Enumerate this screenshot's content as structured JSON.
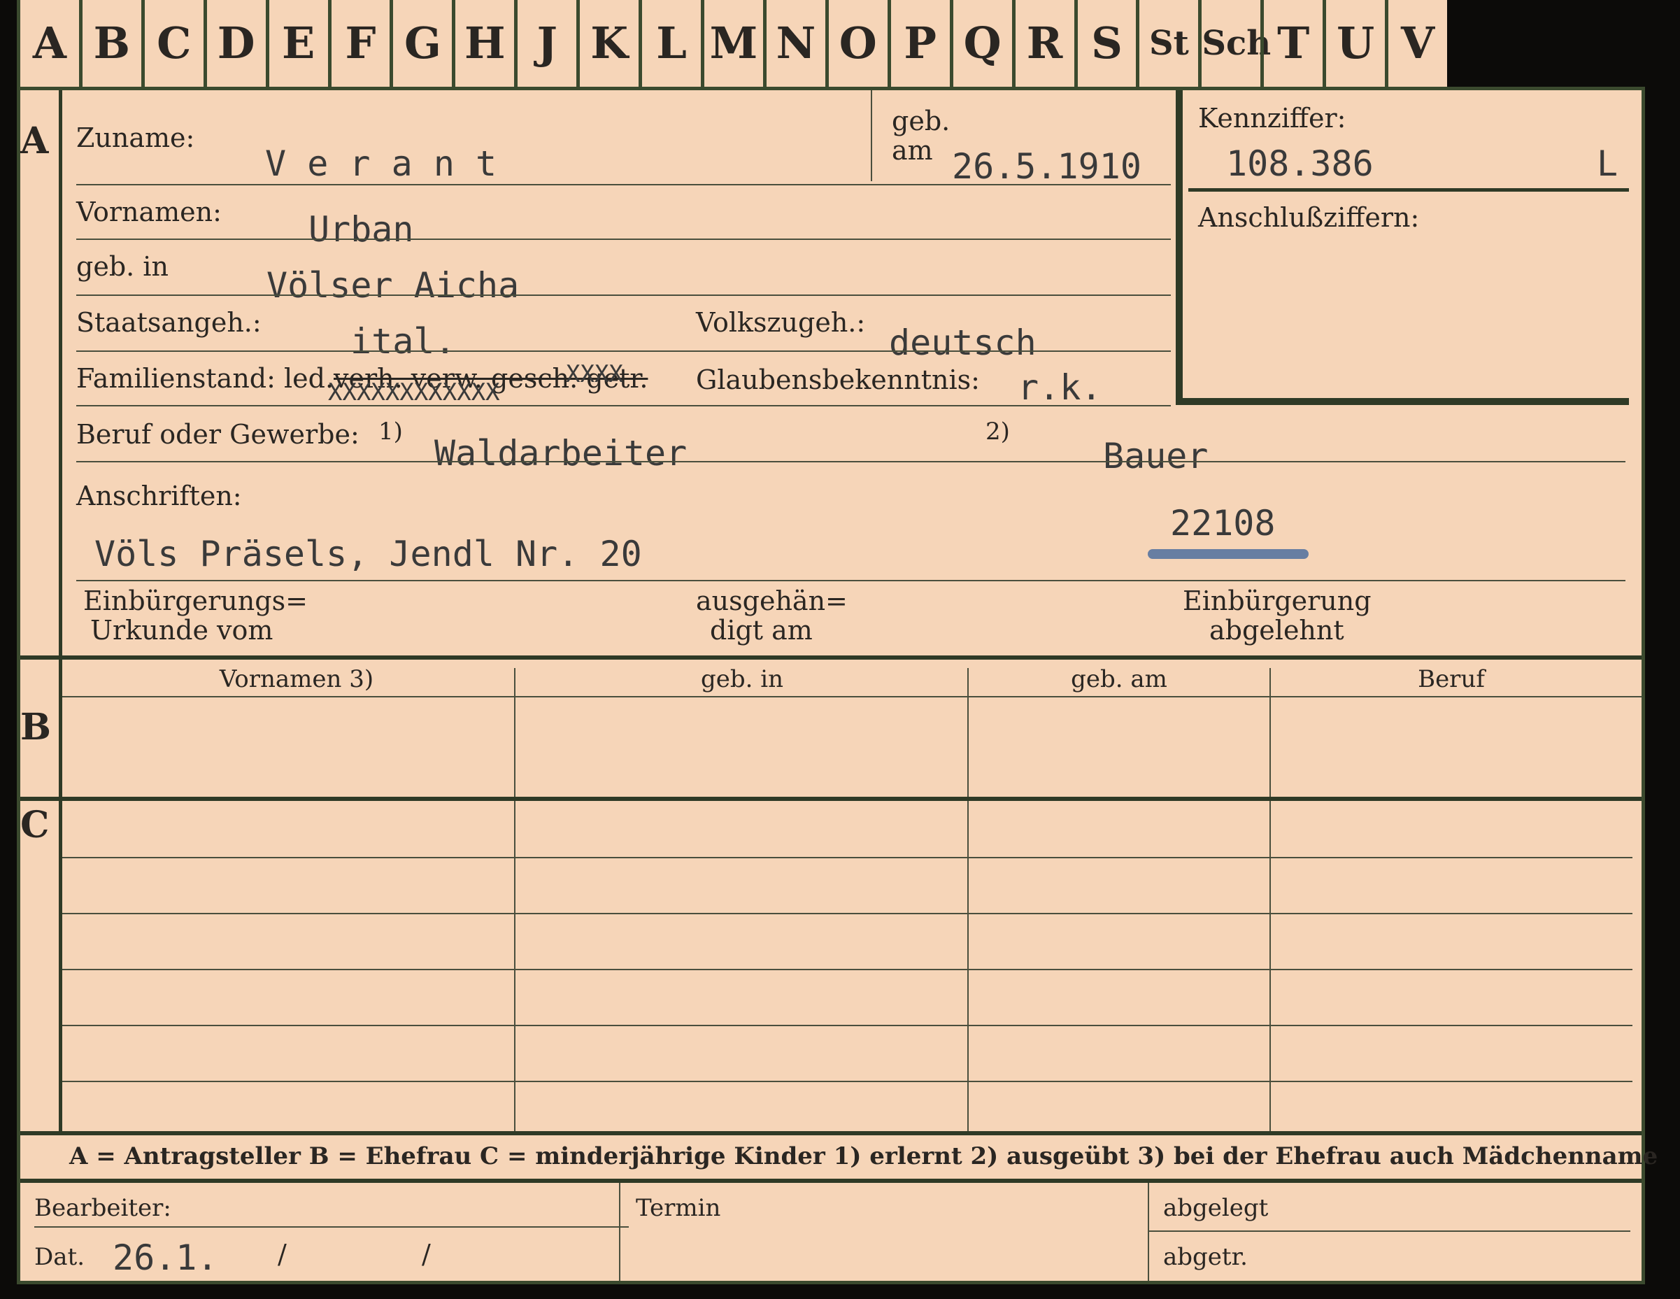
{
  "tabs": [
    "A",
    "B",
    "C",
    "D",
    "E",
    "F",
    "G",
    "H",
    "J",
    "K",
    "L",
    "M",
    "N",
    "O",
    "P",
    "Q",
    "R",
    "S",
    "St",
    "Sch",
    "T",
    "U",
    "V"
  ],
  "section_a": {
    "marker": "A",
    "zuname_label": "Zuname:",
    "zuname_value": "V e r a n t",
    "geb_am_label_1": "geb.",
    "geb_am_label_2": "am",
    "geb_am_value": "26.5.1910",
    "kennziffer_label": "Kennziffer:",
    "kennziffer_value": "108.386",
    "kennziffer_suffix": "L",
    "anschluss_label": "Anschlußziffern:",
    "vornamen_label": "Vornamen:",
    "vornamen_value": "Urban",
    "geb_in_label": "geb. in",
    "geb_in_value": "Völser Aicha",
    "staatsangeh_label": "Staatsangeh.:",
    "staatsangeh_value": "ital.",
    "volkszugeh_label": "Volkszugeh.:",
    "volkszugeh_value": "deutsch",
    "familienstand_label": "Familienstand: led.",
    "familienstand_struck": "verh. verw. gesch. getr.",
    "familienstand_marks": "XXXX",
    "familienstand_marks_under": "XXXXXXXXXXXX",
    "glaubens_label": "Glaubensbekenntnis:",
    "glaubens_value": "r.k.",
    "beruf_label": "Beruf oder Gewerbe:",
    "beruf_note1": "1)",
    "beruf_value1": "Waldarbeiter",
    "beruf_note2": "2)",
    "beruf_value2": "Bauer",
    "anschriften_label": "Anschriften:",
    "anschrift_value": "Völs Präsels, Jendl Nr. 20",
    "anschrift_number": "22108",
    "einbuerg_label_1": "Einbürgerungs=",
    "einbuerg_label_2": "Urkunde vom",
    "ausgeh_label_1": "ausgehän=",
    "ausgeh_label_2": "digt am",
    "abgelehnt_label_1": "Einbürgerung",
    "abgelehnt_label_2": "abgelehnt"
  },
  "section_b": {
    "marker": "B",
    "columns": [
      "Vornamen 3)",
      "geb. in",
      "geb. am",
      "Beruf"
    ]
  },
  "section_c": {
    "marker": "C"
  },
  "legend": "A = Antragsteller   B = Ehefrau   C = minderjährige Kinder   1) erlernt   2) ausgeübt   3) bei der Ehefrau auch Mädchenname",
  "footer": {
    "bearbeiter_label": "Bearbeiter:",
    "dat_label": "Dat.",
    "dat_value": "26.1.",
    "slash1": "/",
    "slash2": "/",
    "termin_label": "Termin",
    "abgelegt_label": "abgelegt",
    "abgetr_label": "abgetr."
  }
}
